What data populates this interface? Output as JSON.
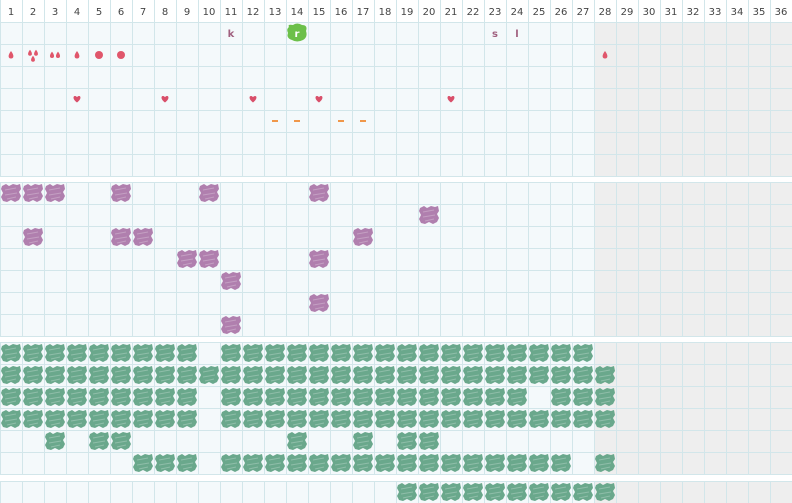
{
  "columns": [
    "1",
    "2",
    "3",
    "4",
    "5",
    "6",
    "7",
    "8",
    "9",
    "10",
    "11",
    "12",
    "13",
    "14",
    "15",
    "16",
    "17",
    "18",
    "19",
    "20",
    "21",
    "22",
    "23",
    "24",
    "25",
    "26",
    "27",
    "28",
    "29",
    "30",
    "31",
    "32",
    "33",
    "34",
    "35",
    "36"
  ],
  "active_columns": 27,
  "colors": {
    "grid_line": "#d2e6ea",
    "cell_bg": "#f4f9fb",
    "inactive_bg": "#eeeeee",
    "header_text": "#444444",
    "section_gap": "#ffffff",
    "drop_red": "#e0566b",
    "heart_red": "#d94f6a",
    "dash_orange": "#f0974a",
    "letter_purple": "#a0607f",
    "selected_green": "#6cc04a",
    "purple_blob": "#b07fae",
    "green_blob": "#6aa88c"
  },
  "top_section": {
    "letters": [
      {
        "text": "k",
        "col": 11,
        "row": 1
      },
      {
        "text": "r",
        "col": 14,
        "row": 1,
        "selected": true
      },
      {
        "text": "s",
        "col": 23,
        "row": 1
      },
      {
        "text": "l",
        "col": 24,
        "row": 1
      }
    ],
    "marks": [
      {
        "kind": "drop",
        "col": 1,
        "row": 2
      },
      {
        "kind": "drop-cluster",
        "col": 2,
        "row": 2
      },
      {
        "kind": "drop-pair",
        "col": 3,
        "row": 2
      },
      {
        "kind": "drop",
        "col": 4,
        "row": 2
      },
      {
        "kind": "dot",
        "col": 5,
        "row": 2
      },
      {
        "kind": "dot",
        "col": 6,
        "row": 2
      },
      {
        "kind": "drop",
        "col": 28,
        "row": 2
      },
      {
        "kind": "heart",
        "col": 4,
        "row": 4
      },
      {
        "kind": "heart",
        "col": 8,
        "row": 4
      },
      {
        "kind": "heart",
        "col": 12,
        "row": 4
      },
      {
        "kind": "heart",
        "col": 15,
        "row": 4
      },
      {
        "kind": "heart",
        "col": 21,
        "row": 4
      },
      {
        "kind": "dash",
        "col": 13,
        "row": 5
      },
      {
        "kind": "dash",
        "col": 14,
        "row": 5
      },
      {
        "kind": "dash",
        "col": 16,
        "row": 5
      },
      {
        "kind": "dash",
        "col": 17,
        "row": 5
      }
    ]
  },
  "middle_section": {
    "purple_cells": [
      [
        1,
        0
      ],
      [
        2,
        0
      ],
      [
        3,
        0
      ],
      [
        6,
        0
      ],
      [
        10,
        0
      ],
      [
        15,
        0
      ],
      [
        20,
        1
      ],
      [
        2,
        2
      ],
      [
        6,
        2
      ],
      [
        7,
        2
      ],
      [
        17,
        2
      ],
      [
        9,
        3
      ],
      [
        10,
        3
      ],
      [
        15,
        3
      ],
      [
        11,
        4
      ],
      [
        15,
        5
      ],
      [
        11,
        6
      ]
    ]
  },
  "bottom_section": {
    "green_rows": [
      [
        1,
        2,
        3,
        4,
        5,
        6,
        7,
        8,
        9,
        11,
        12,
        13,
        14,
        15,
        16,
        17,
        18,
        19,
        20,
        21,
        22,
        23,
        24,
        25,
        26,
        27
      ],
      [
        1,
        2,
        3,
        4,
        5,
        6,
        7,
        8,
        9,
        10,
        11,
        12,
        13,
        14,
        15,
        16,
        17,
        18,
        19,
        20,
        21,
        22,
        23,
        24,
        25,
        26,
        27,
        28
      ],
      [
        1,
        2,
        3,
        4,
        5,
        6,
        7,
        8,
        9,
        11,
        12,
        13,
        14,
        15,
        16,
        17,
        18,
        19,
        20,
        21,
        22,
        23,
        24,
        26,
        27,
        28
      ],
      [
        1,
        2,
        3,
        4,
        5,
        6,
        7,
        8,
        9,
        11,
        12,
        13,
        14,
        15,
        16,
        17,
        18,
        19,
        20,
        21,
        22,
        23,
        24,
        25,
        26,
        27,
        28
      ],
      [
        3,
        5,
        6,
        14,
        17,
        19,
        20
      ],
      [
        7,
        8,
        9,
        11,
        12,
        13,
        14,
        15,
        16,
        17,
        18,
        19,
        20,
        21,
        22,
        23,
        24,
        25,
        26,
        28
      ]
    ],
    "footer_green": [
      19,
      20,
      21,
      22,
      23,
      24,
      25,
      26,
      27,
      28
    ]
  }
}
